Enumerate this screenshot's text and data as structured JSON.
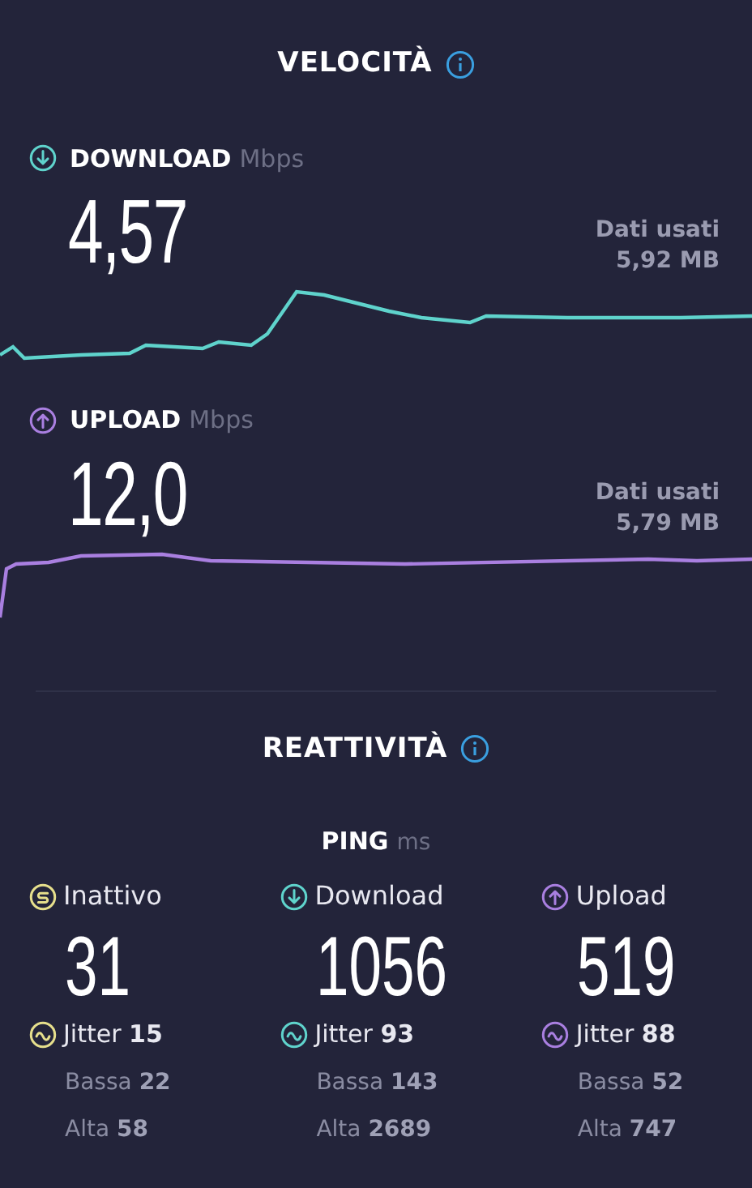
{
  "speed_title": "VELOCITÀ",
  "speed": [
    {
      "kind": "download",
      "label": "DOWNLOAD",
      "unit": "Mbps",
      "value": "4,57",
      "data_label": "Dati usati",
      "data_value": "5,92 MB",
      "color": "#5fd3cc"
    },
    {
      "kind": "upload",
      "label": "UPLOAD",
      "unit": "Mbps",
      "value": "12,0",
      "data_label": "Dati usati",
      "data_value": "5,79 MB",
      "color": "#a97fe0"
    }
  ],
  "responsiveness_title": "REATTIVITÀ",
  "ping": {
    "label": "PING",
    "unit": "ms",
    "columns": [
      {
        "kind": "idle",
        "label": "Inattivo",
        "value": "31",
        "jitter": "Jitter **15**",
        "low": "Bassa **22**",
        "high": "Alta **58**",
        "color": "#e6df8c"
      },
      {
        "kind": "download",
        "label": "Download",
        "value": "1056",
        "jitter": "Jitter **93**",
        "low": "Bassa **143**",
        "high": "Alta **2689**",
        "color": "#5fd3cc"
      },
      {
        "kind": "upload",
        "label": "Upload",
        "value": "519",
        "jitter": "Jitter **88**",
        "low": "Bassa **52**",
        "high": "Alta **747**",
        "color": "#a97fe0"
      }
    ]
  }
}
